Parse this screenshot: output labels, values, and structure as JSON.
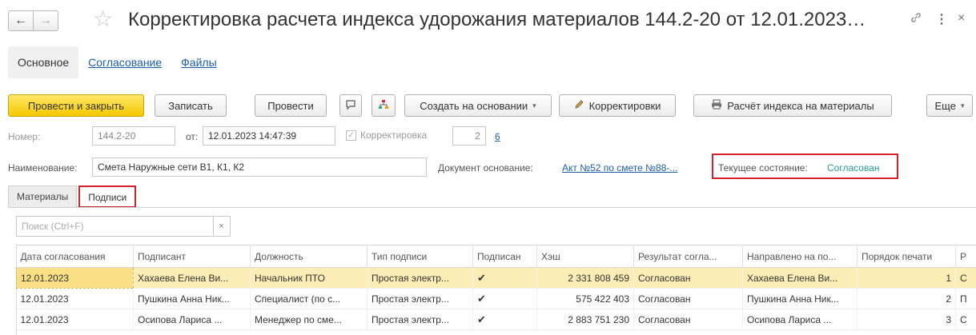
{
  "window": {
    "title": "Корректировка расчета индекса удорожания материалов 144.2-20  от 12.01.2023…",
    "back_glyph": "←",
    "forward_glyph": "→",
    "star_glyph": "☆",
    "link_glyph": "🔗",
    "more_glyph": "⋮",
    "close_glyph": "×"
  },
  "sections": [
    "Основное",
    "Согласование",
    "Файлы"
  ],
  "toolbar": {
    "post_close": "Провести и закрыть",
    "save": "Записать",
    "post": "Провести",
    "create_based": "Создать на основании",
    "corrections": "Корректировки",
    "index_calc": "Расчёт индекса на материалы",
    "more": "Еще",
    "caret": "▾"
  },
  "fields": {
    "number_label": "Номер:",
    "number_value": "144.2-20",
    "date_label": "от:",
    "date_value": "12.01.2023 14:47:39",
    "correction_label": "Корректировка",
    "correction_value": "2",
    "correction_link": "6",
    "name_label": "Наименование:",
    "name_value": "Смета Наружные сети В1, К1, К2",
    "base_doc_label": "Документ основание:",
    "base_doc_value": "Акт №52 по смете №88-...",
    "state_label": "Текущее состояние:",
    "state_value": "Согласован"
  },
  "tabs": [
    "Материалы",
    "Подписи"
  ],
  "search": {
    "placeholder": "Поиск (Ctrl+F)",
    "clear": "×"
  },
  "table": {
    "columns": [
      "Дата согласования",
      "Подписант",
      "Должность",
      "Тип подписи",
      "Подписан",
      "Хэш",
      "Результат согла...",
      "Направлено на по...",
      "Порядок печати",
      "Р"
    ],
    "rows": [
      [
        "12.01.2023",
        "Хахаева Елена Ви...",
        "Начальник ПТО",
        "Простая электр...",
        "✔",
        "2 331 808 459",
        "Согласован",
        "Хахаева Елена Ви...",
        "1",
        "С"
      ],
      [
        "12.01.2023",
        "Пушкина Анна Ник...",
        "Специалист (по с...",
        "Простая электр...",
        "✔",
        "575 422 403",
        "Согласован",
        "Пушкина Анна Ник...",
        "2",
        "П"
      ],
      [
        "12.01.2023",
        "Осипова Лариса ...",
        "Менеджер по сме...",
        "Простая электр...",
        "✔",
        "2 883 751 230",
        "Согласован",
        "Осипова Лариса ...",
        "3",
        "С"
      ]
    ]
  }
}
